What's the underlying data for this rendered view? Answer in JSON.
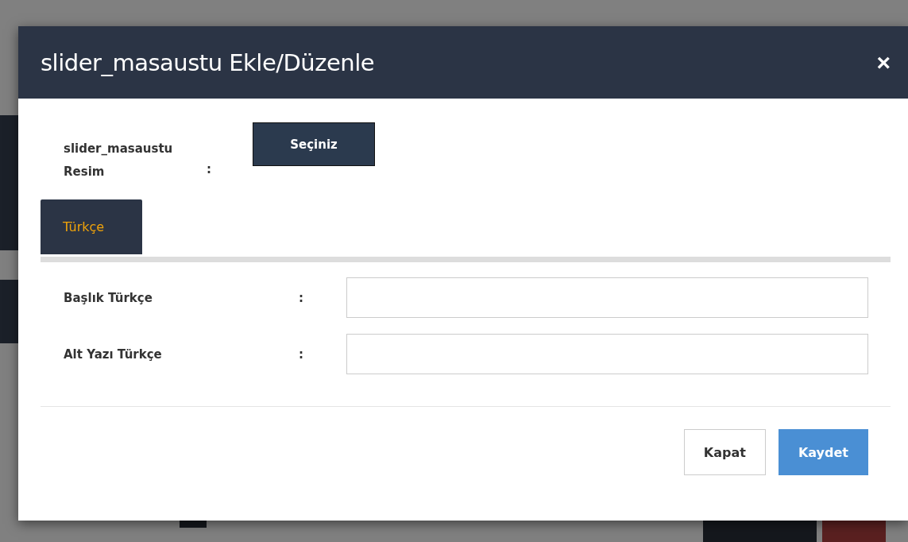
{
  "dialog": {
    "title": "slider_masaustu Ekle/Düzenle",
    "close": "×"
  },
  "image_field": {
    "label": "slider_masaustu Resim",
    "colon": ":",
    "button": "Seçiniz"
  },
  "tabs": [
    {
      "label": "Türkçe",
      "selected": true
    }
  ],
  "fields": [
    {
      "label": "Başlık Türkçe",
      "colon": ":"
    },
    {
      "label": "Alt Yazı Türkçe",
      "colon": ":"
    }
  ],
  "buttons": [
    {
      "label": "Kapat",
      "kind": "secondary"
    },
    {
      "label": "Kaydet",
      "kind": "primary"
    }
  ]
}
